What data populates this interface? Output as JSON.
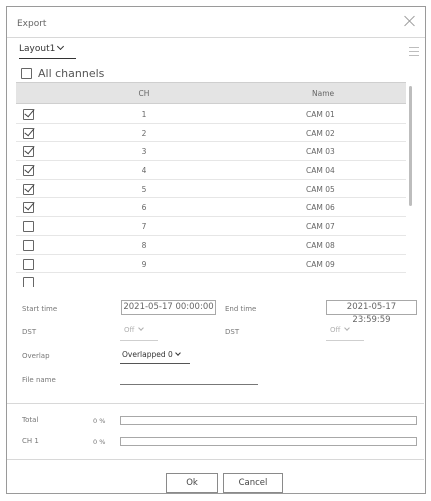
{
  "dialog": {
    "title": "Export"
  },
  "layout": {
    "selected": "Layout1"
  },
  "all_channels": {
    "label": "All channels",
    "checked": false
  },
  "table": {
    "columns": {
      "ch": "CH",
      "name": "Name"
    },
    "rows": [
      {
        "ch": "1",
        "name": "CAM 01",
        "checked": true
      },
      {
        "ch": "2",
        "name": "CAM 02",
        "checked": true
      },
      {
        "ch": "3",
        "name": "CAM 03",
        "checked": true
      },
      {
        "ch": "4",
        "name": "CAM 04",
        "checked": true
      },
      {
        "ch": "5",
        "name": "CAM 05",
        "checked": true
      },
      {
        "ch": "6",
        "name": "CAM 06",
        "checked": true
      },
      {
        "ch": "7",
        "name": "CAM 07",
        "checked": false
      },
      {
        "ch": "8",
        "name": "CAM 08",
        "checked": false
      },
      {
        "ch": "9",
        "name": "CAM 09",
        "checked": false
      },
      {
        "ch": "",
        "name": "",
        "checked": false
      }
    ]
  },
  "form": {
    "start_time_label": "Start time",
    "start_time_value": "2021-05-17 00:00:00",
    "end_time_label": "End time",
    "end_time_value": "2021-05-17 23:59:59",
    "dst_label": "DST",
    "dst_value": "Off",
    "dst2_label": "DST",
    "dst2_value": "Off",
    "overlap_label": "Overlap",
    "overlap_value": "Overlapped 0",
    "file_name_label": "File name",
    "file_name_value": ""
  },
  "progress": {
    "total_label": "Total",
    "total_pct_text": "0 %",
    "total_fraction": 0,
    "ch_label": "CH 1",
    "ch_pct_text": "0 %",
    "ch_fraction": 0
  },
  "buttons": {
    "ok": "Ok",
    "cancel": "Cancel"
  }
}
